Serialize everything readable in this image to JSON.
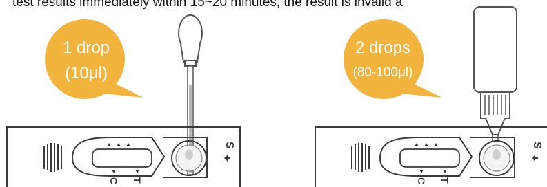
{
  "instruction_text": "test results immediately within 15~20 minutes, the result is invalid a",
  "panel_left": {
    "bubble_line1": "1 drop",
    "bubble_line2": "(10μl)"
  },
  "panel_right": {
    "bubble_line1": "2 drops",
    "bubble_line2": "(80-100μl)"
  },
  "cassette_labels": {
    "sample": "S",
    "control": "C",
    "test": "T"
  },
  "colors": {
    "bubble": "#f2b43c",
    "outline": "#3a3a3a",
    "text": "#111111"
  },
  "icons": [
    "dropper-icon",
    "buffer-bottle-icon",
    "arrow-icon"
  ]
}
